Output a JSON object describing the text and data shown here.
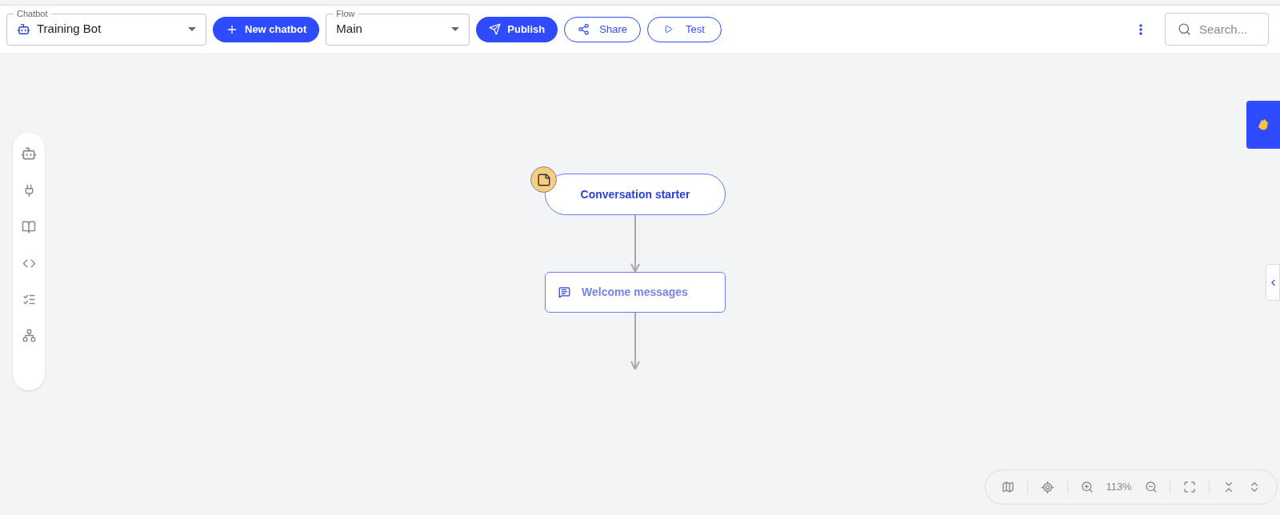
{
  "toolbar": {
    "chatbot_select": {
      "label": "Chatbot",
      "value": "Training Bot"
    },
    "new_chatbot_button": "New chatbot",
    "flow_select": {
      "label": "Flow",
      "value": "Main"
    },
    "publish_button": "Publish",
    "share_button": "Share",
    "test_button": "Test",
    "search": {
      "placeholder": "Search..."
    }
  },
  "canvas": {
    "nodes": [
      {
        "kind": "start",
        "title": "Conversation starter"
      },
      {
        "kind": "message",
        "title": "Welcome messages"
      }
    ]
  },
  "zoom_controls": {
    "zoom_level": "113%"
  }
}
